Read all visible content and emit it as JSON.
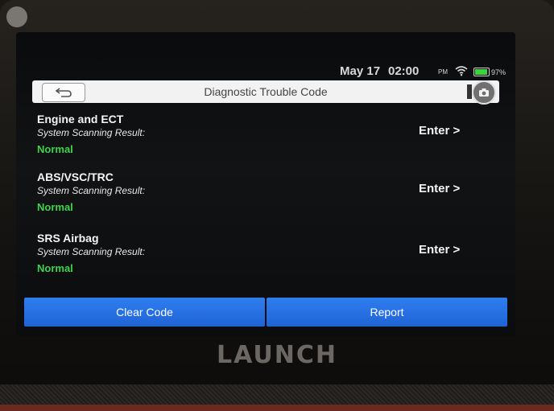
{
  "status": {
    "date": "May 17",
    "time": "02:00",
    "ampm": "PM",
    "battery": "97%"
  },
  "header": {
    "title": "Diagnostic Trouble Code"
  },
  "systems": [
    {
      "name": "Engine and ECT",
      "result_label": "System Scanning Result:",
      "status": "Normal",
      "action": "Enter >"
    },
    {
      "name": "ABS/VSC/TRC",
      "result_label": "System Scanning Result:",
      "status": "Normal",
      "action": "Enter >"
    },
    {
      "name": "SRS Airbag",
      "result_label": "System Scanning Result:",
      "status": "Normal",
      "action": "Enter >"
    }
  ],
  "footer": {
    "clear_label": "Clear Code",
    "report_label": "Report"
  },
  "device": {
    "brand": "LAUNCH"
  },
  "colors": {
    "accent_blue": "#2a74e8",
    "status_green": "#3cd44a",
    "battery_green": "#3bd43b"
  }
}
